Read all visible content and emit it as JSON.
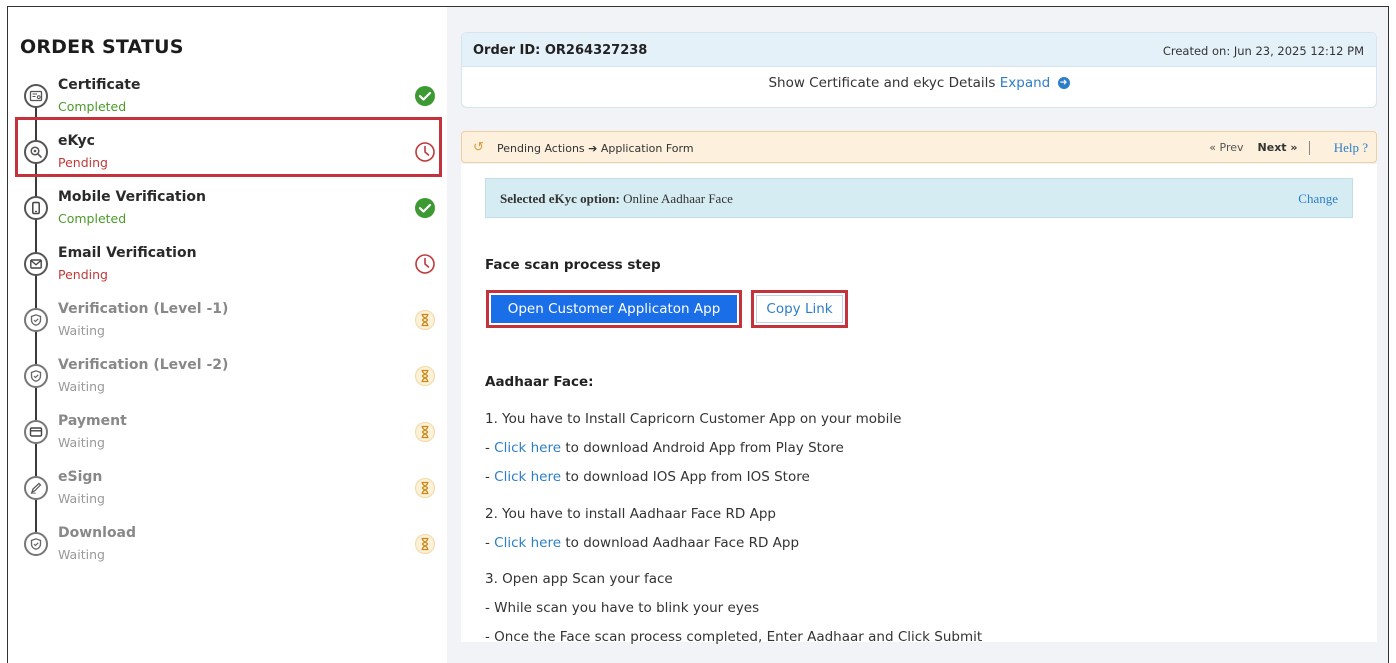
{
  "order_status": {
    "title": "ORDER STATUS",
    "steps": [
      {
        "name": "Certificate",
        "status": "Completed",
        "state": "completed",
        "icon": "certificate-icon"
      },
      {
        "name": "eKyc",
        "status": "Pending",
        "state": "pending",
        "icon": "search-icon"
      },
      {
        "name": "Mobile Verification",
        "status": "Completed",
        "state": "completed",
        "icon": "mobile-icon"
      },
      {
        "name": "Email Verification",
        "status": "Pending",
        "state": "pending",
        "icon": "mail-icon"
      },
      {
        "name": "Verification (Level -1)",
        "status": "Waiting",
        "state": "waiting",
        "icon": "shield-icon"
      },
      {
        "name": "Verification (Level -2)",
        "status": "Waiting",
        "state": "waiting",
        "icon": "shield-icon"
      },
      {
        "name": "Payment",
        "status": "Waiting",
        "state": "waiting",
        "icon": "card-icon"
      },
      {
        "name": "eSign",
        "status": "Waiting",
        "state": "waiting",
        "icon": "pen-icon"
      },
      {
        "name": "Download",
        "status": "Waiting",
        "state": "waiting",
        "icon": "shield-icon"
      }
    ]
  },
  "order": {
    "id_label": "Order ID: OR264327238",
    "created": "Created on: Jun 23, 2025 12:12 PM",
    "show_text": "Show Certificate and ekyc Details",
    "expand": "Expand"
  },
  "pending_bar": {
    "crumb": "Pending Actions ➔ Application Form",
    "prev": "« Prev",
    "next": "Next »",
    "help": "Help ?"
  },
  "ekyc_option": {
    "label": "Selected eKyc option:",
    "value": " Online Aadhaar Face",
    "change": "Change"
  },
  "face_scan": {
    "title": "Face scan process step",
    "open_app": "Open Customer Applicaton App",
    "copy_link": "Copy Link"
  },
  "aadhaar": {
    "title": "Aadhaar Face:",
    "line1": "1. You have to Install Capricorn Customer App on your mobile",
    "click_here": "Click here",
    "line1a": " to download Android App from Play Store",
    "line1b": " to download IOS App from IOS Store",
    "line2": "2. You have to install Aadhaar Face RD App",
    "line2a": " to download Aadhaar Face RD App",
    "line3": "3. Open app Scan your face",
    "line3a": " - While scan you have to blink your eyes",
    "line3b": " - Once the Face scan process completed, Enter Aadhaar and Click Submit",
    "dash": " - "
  },
  "colors": {
    "completed": "#4c9a2a",
    "pending": "#c03a3a",
    "waiting": "#d8a53a",
    "accent": "#1a6fe8",
    "link": "#2d7ec9",
    "highlight": "#c4323c"
  }
}
